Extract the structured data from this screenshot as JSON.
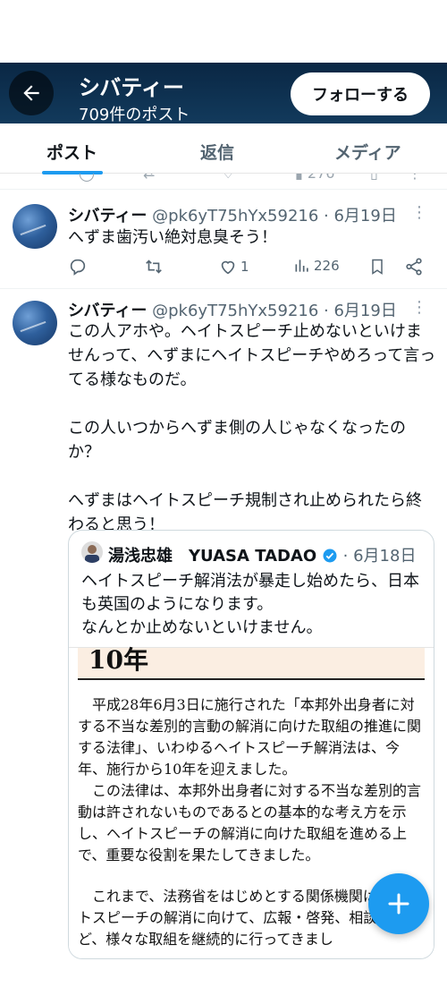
{
  "header": {
    "title": "シバティー",
    "post_count": "709件のポスト",
    "follow_label": "フォローする",
    "gradient_top": "#0a2744",
    "gradient_bottom": "#123a5c"
  },
  "tabs": [
    {
      "label": "ポスト",
      "active": true
    },
    {
      "label": "返信",
      "active": false
    },
    {
      "label": "メディア",
      "active": false
    }
  ],
  "prev_tweet": {
    "views": "276"
  },
  "tweets": [
    {
      "name": "シバティー",
      "handle": "@pk6yT75hYx59216",
      "date": "6月19日",
      "text": "へずま歯汚い絶対息臭そう！",
      "likes": "1",
      "views": "226"
    },
    {
      "name": "シバティー",
      "handle": "@pk6yT75hYx59216",
      "date": "6月19日",
      "text": "この人アホや。ヘイトスピーチ止めないといけませんって、へずまにヘイトスピーチやめろって言ってる様なものだ。\n\nこの人いつからへずま側の人じゃなくなったのか？\n\nへずまはヘイトスピーチ規制され止められたら終わると思う！",
      "quote": {
        "name": "湯浅忠雄　YUASA TADAO",
        "date": "6月18日",
        "text": "ヘイトスピーチ解消法が暴走し始めたら、日本も英国のようになります。\nなんとか止めないといけません。",
        "image_header": "10年",
        "image_paragraphs": [
          "　平成28年6月3日に施行された「本邦外出身者に対する不当な差別的言動の解消に向けた取組の推進に関する法律」、いわゆるヘイトスピーチ解消法は、今年、施行から10年を迎えました。",
          "　この法律は、本邦外出身者に対する不当な差別的言動は許されないものであるとの基本的な考え方を示し、ヘイトスピーチの解消に向けた取組を進める上で、重要な役割を果たしてきました。",
          "　これまで、法務省をはじめとする関係機関は、ヘイトスピーチの解消に向けて、広報・啓発、相談対応など、様々な取組を継続的に行ってきまし"
        ]
      }
    }
  ],
  "colors": {
    "accent": "#1d9bf0",
    "secondary_text": "#536471",
    "verified": "#1d9bf0"
  },
  "icons": [
    "back-arrow-icon",
    "reply-icon",
    "retweet-icon",
    "like-icon",
    "views-icon",
    "bookmark-icon",
    "share-icon",
    "more-icon",
    "verified-icon",
    "plus-icon"
  ]
}
